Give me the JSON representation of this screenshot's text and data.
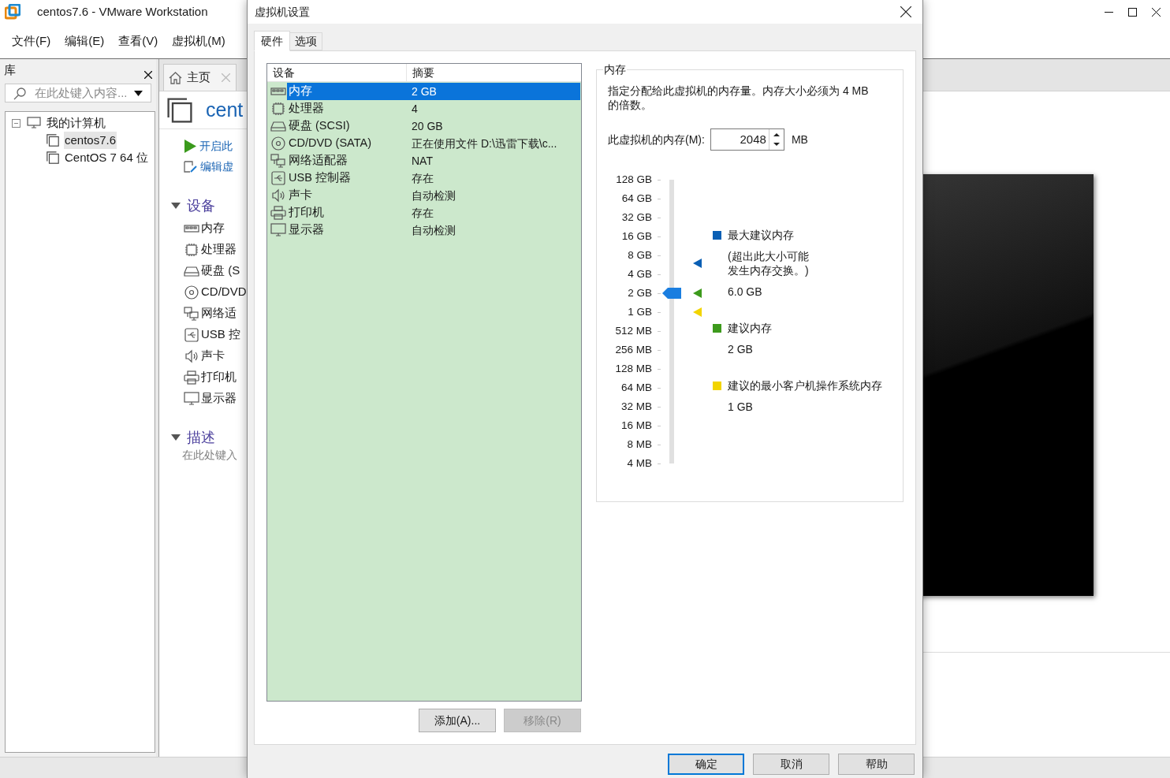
{
  "app_window": {
    "title": "centos7.6 - VMware Workstation"
  },
  "menu": [
    "文件(F)",
    "编辑(E)",
    "查看(V)",
    "虚拟机(M)"
  ],
  "library": {
    "title": "库",
    "search": {
      "placeholder": "在此处键入内容..."
    },
    "tree": [
      {
        "label": "我的计算机",
        "expanded": true,
        "selected": false,
        "children": [
          {
            "label": "centos7.6",
            "selected": true
          },
          {
            "label": "CentOS 7 64 位",
            "selected": false
          }
        ]
      }
    ]
  },
  "home_tab": {
    "label": "主页"
  },
  "vm_page": {
    "title": "cent",
    "actions": [
      {
        "kind": "power_on",
        "label": "开启此"
      },
      {
        "kind": "edit",
        "label": "编辑虚"
      }
    ],
    "sections": [
      {
        "title": "设备",
        "expanded": true,
        "devices": [
          {
            "kind": "memory",
            "label": "内存"
          },
          {
            "kind": "cpu",
            "label": "处理器"
          },
          {
            "kind": "disk",
            "label": "硬盘 (S"
          },
          {
            "kind": "cdrom",
            "label": "CD/DVD"
          },
          {
            "kind": "network",
            "label": "网络适"
          },
          {
            "kind": "usb",
            "label": "USB 控"
          },
          {
            "kind": "sound",
            "label": "声卡"
          },
          {
            "kind": "printer",
            "label": "打印机"
          },
          {
            "kind": "display",
            "label": "显示器"
          }
        ]
      },
      {
        "title": "描述",
        "expanded": true,
        "text": "在此处键入"
      }
    ]
  },
  "dialog": {
    "title": "虚拟机设置",
    "tabs": [
      {
        "label": "硬件",
        "selected": true
      },
      {
        "label": "选项",
        "selected": false
      }
    ],
    "device_list": {
      "columns": [
        "设备",
        "摘要"
      ],
      "rows": [
        {
          "kind": "memory",
          "device": "内存",
          "summary": "2 GB",
          "selected": true
        },
        {
          "kind": "cpu",
          "device": "处理器",
          "summary": "4",
          "selected": false
        },
        {
          "kind": "disk",
          "device": "硬盘 (SCSI)",
          "summary": "20 GB",
          "selected": false
        },
        {
          "kind": "cdrom",
          "device": "CD/DVD (SATA)",
          "summary": "正在使用文件 D:\\迅雷下载\\c...",
          "selected": false
        },
        {
          "kind": "network",
          "device": "网络适配器",
          "summary": "NAT",
          "selected": false
        },
        {
          "kind": "usb",
          "device": "USB 控制器",
          "summary": "存在",
          "selected": false
        },
        {
          "kind": "sound",
          "device": "声卡",
          "summary": "自动检测",
          "selected": false
        },
        {
          "kind": "printer",
          "device": "打印机",
          "summary": "存在",
          "selected": false
        },
        {
          "kind": "display",
          "device": "显示器",
          "summary": "自动检测",
          "selected": false
        }
      ]
    },
    "list_buttons": [
      {
        "label": "添加(A)...",
        "disabled": false
      },
      {
        "label": "移除(R)",
        "disabled": true
      }
    ],
    "memory": {
      "title": "内存",
      "description_lines": [
        "指定分配给此虚拟机的内存量。内存大小必须为 4 MB",
        "的倍数。"
      ],
      "field_label": "此虚拟机的内存(M):",
      "value": "2048",
      "unit": "MB",
      "scale": [
        "128 GB",
        "64 GB",
        "32 GB",
        "16 GB",
        "8 GB",
        "4 GB",
        "2 GB",
        "1 GB",
        "512 MB",
        "256 MB",
        "128 MB",
        "64 MB",
        "32 MB",
        "16 MB",
        "8 MB",
        "4 MB"
      ],
      "level": 0.6,
      "markers": [
        {
          "color": "#0a5fb4",
          "level": 0.705
        },
        {
          "color": "#3d9a1c",
          "level": 0.6
        },
        {
          "color": "#f2d400",
          "level": 0.533
        }
      ],
      "legend": [
        {
          "color": "#0a5fb4",
          "label": "最大建议内存",
          "note_lines": [
            "(超出此大小可能",
            "发生内存交换。)"
          ],
          "value": "6.0 GB"
        },
        {
          "color": "#3d9a1c",
          "label": "建议内存",
          "value": "2 GB"
        },
        {
          "color": "#f2d400",
          "label": "建议的最小客户机操作系统内存",
          "value": "1 GB"
        }
      ]
    },
    "buttons": [
      {
        "label": "确定",
        "default": true
      },
      {
        "label": "取消",
        "default": false
      },
      {
        "label": "帮助",
        "default": false
      }
    ]
  }
}
